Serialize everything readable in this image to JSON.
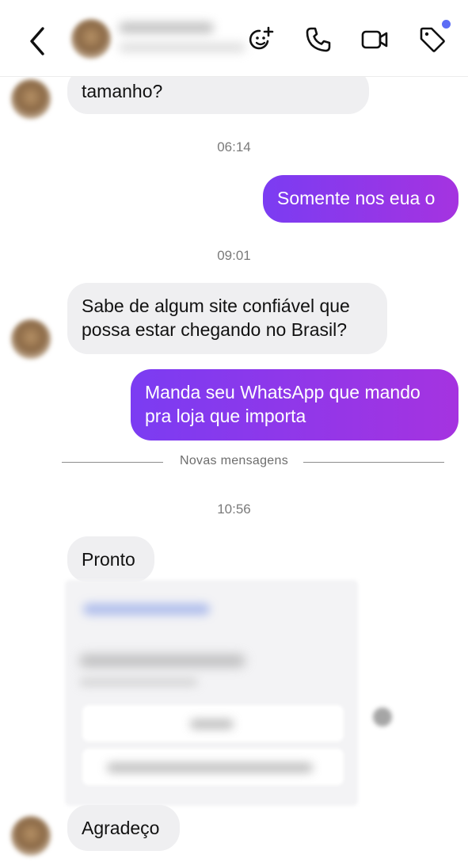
{
  "header": {
    "icons": [
      "chevron-left-icon",
      "sticker-plus-icon",
      "phone-icon",
      "video-camera-icon",
      "tag-icon"
    ],
    "accent_dot_color": "#5b6cf5"
  },
  "messages": [
    {
      "dir": "in",
      "text": "tamanho?"
    },
    {
      "dir": "time",
      "text": "06:14"
    },
    {
      "dir": "out",
      "text": "Somente nos eua o"
    },
    {
      "dir": "time",
      "text": "09:01"
    },
    {
      "dir": "in",
      "line1": "Sabe de algum site confiável que",
      "line2": "possa estar chegando no Brasil?"
    },
    {
      "dir": "out",
      "line1": "Manda seu WhatsApp que mando",
      "line2": "pra loja que importa"
    },
    {
      "dir": "divider",
      "text": "Novas mensagens"
    },
    {
      "dir": "time",
      "text": "10:56"
    },
    {
      "dir": "in",
      "text": "Pronto"
    },
    {
      "dir": "in",
      "text": "Agradeço"
    }
  ],
  "colors": {
    "incoming_bubble": "#efeff1",
    "outgoing_gradient_start": "#a533e0",
    "outgoing_gradient_end": "#7b3cf2"
  }
}
